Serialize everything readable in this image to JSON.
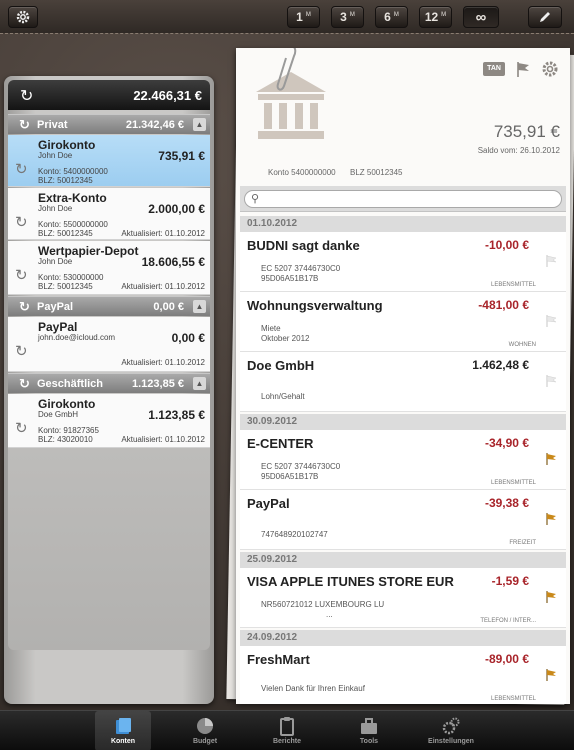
{
  "toolbar": {
    "periods": [
      {
        "num": "1",
        "unit": "M"
      },
      {
        "num": "3",
        "unit": "M"
      },
      {
        "num": "6",
        "unit": "M"
      },
      {
        "num": "12",
        "unit": "M"
      }
    ],
    "all_label": "∞"
  },
  "accounts_panel": {
    "total": "22.466,31 €",
    "groups": [
      {
        "name": "Privat",
        "sum": "21.342,46 €"
      },
      {
        "name": "PayPal",
        "sum": "0,00 €"
      },
      {
        "name": "Geschäftlich",
        "sum": "1.123,85 €"
      }
    ],
    "accounts": [
      {
        "name": "Girokonto",
        "owner": "John Doe",
        "amount": "735,91 €",
        "line1": "Konto: 5400000000",
        "line2": "BLZ: 50012345",
        "updated": ""
      },
      {
        "name": "Extra-Konto",
        "owner": "John Doe",
        "amount": "2.000,00 €",
        "line1": "Konto: 5500000000",
        "line2": "BLZ: 50012345",
        "updated": "Aktualisiert: 01.10.2012"
      },
      {
        "name": "Wertpapier-Depot",
        "owner": "John Doe",
        "amount": "18.606,55 €",
        "line1": "Konto: 530000000",
        "line2": "BLZ: 50012345",
        "updated": "Aktualisiert: 01.10.2012"
      },
      {
        "name": "PayPal",
        "owner": "john.doe@icloud.com",
        "amount": "0,00 €",
        "line1": "",
        "line2": "",
        "updated": "Aktualisiert: 01.10.2012"
      },
      {
        "name": "Girokonto",
        "owner": "Doe GmbH",
        "amount": "1.123,85 €",
        "line1": "Konto: 91827365",
        "line2": "BLZ: 43020010",
        "updated": "Aktualisiert: 01.10.2012"
      }
    ]
  },
  "detail": {
    "tan_label": "TAN",
    "balance": "735,91 €",
    "balance_date": "Saldo vom: 26.10.2012",
    "konto": "Konto 5400000000",
    "blz": "BLZ 50012345",
    "dates": [
      "01.10.2012",
      "30.09.2012",
      "25.09.2012",
      "24.09.2012"
    ],
    "transactions": [
      {
        "name": "BUDNI sagt danke",
        "amount": "-10,00 €",
        "desc1": "EC 5207 37446730C0",
        "desc2": "95D06A51B17B",
        "category": "LEBENSMITTEL",
        "flag": "white"
      },
      {
        "name": "Wohnungsverwaltung",
        "amount": "-481,00 €",
        "desc1": "Miete",
        "desc2": "Oktober 2012",
        "category": "WOHNEN",
        "flag": "white"
      },
      {
        "name": "Doe GmbH",
        "amount": "1.462,48 €",
        "desc1": "Lohn/Gehalt",
        "desc2": "",
        "category": "",
        "flag": "white"
      },
      {
        "name": "E-CENTER",
        "amount": "-34,90 €",
        "desc1": "EC 5207 37446730C0",
        "desc2": "95D06A51B17B",
        "category": "LEBENSMITTEL",
        "flag": "orange"
      },
      {
        "name": "PayPal",
        "amount": "-39,38 €",
        "desc1": "747648920102747",
        "desc2": "",
        "category": "FREIZEIT",
        "flag": "orange"
      },
      {
        "name": "VISA APPLE ITUNES STORE EUR",
        "amount": "-1,59 €",
        "desc1": "NR560721012 LUXEMBOURG    LU",
        "desc2": "...",
        "category": "TELEFON / INTER...",
        "flag": "orange"
      },
      {
        "name": "FreshMart",
        "amount": "-89,00 €",
        "desc1": "Vielen Dank für Ihren Einkauf",
        "desc2": "",
        "category": "LEBENSMITTEL",
        "flag": "orange"
      }
    ]
  },
  "tabs": [
    {
      "label": "Konten"
    },
    {
      "label": "Budget"
    },
    {
      "label": "Berichte"
    },
    {
      "label": "Tools"
    },
    {
      "label": "Einstellungen"
    }
  ],
  "colors": {
    "negative": "#a8242a",
    "selected": "#9ccdf0",
    "flag_orange": "#c9891a"
  }
}
